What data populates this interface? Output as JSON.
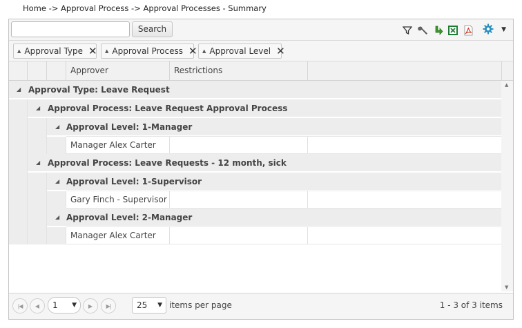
{
  "breadcrumb": "Home -> Approval Process -> Approval Processes - Summary",
  "toolbar": {
    "search_value": "",
    "search_placeholder": "",
    "search_label": "Search",
    "icons": [
      "filter-icon",
      "wrench-icon",
      "refresh-icon",
      "excel-export-icon",
      "pdf-export-icon",
      "gear-icon"
    ]
  },
  "groups": [
    {
      "label": "Approval Type"
    },
    {
      "label": "Approval Process"
    },
    {
      "label": "Approval Level"
    }
  ],
  "columns": [
    "Approver",
    "Restrictions"
  ],
  "rows": {
    "type_1": "Approval Type: Leave Request",
    "process_1": "Approval Process: Leave Request Approval Process",
    "level_1": "Approval Level: 1-Manager",
    "item_1": "Manager Alex Carter",
    "process_2": "Approval Process: Leave Requests - 12 month, sick",
    "level_2": "Approval Level: 1-Supervisor",
    "item_2": "Gary Finch - Supervisor",
    "level_3": "Approval Level: 2-Manager",
    "item_3": "Manager Alex Carter"
  },
  "pager": {
    "page": "1",
    "page_size": "25",
    "items_per_page_label": "items per page",
    "info": "1 - 3 of 3 items"
  },
  "colors": {
    "accent_gear": "#2a8fbd",
    "excel_green": "#1f7a36",
    "pdf_red": "#d23a2a",
    "refresh_green": "#3a9a2a"
  }
}
